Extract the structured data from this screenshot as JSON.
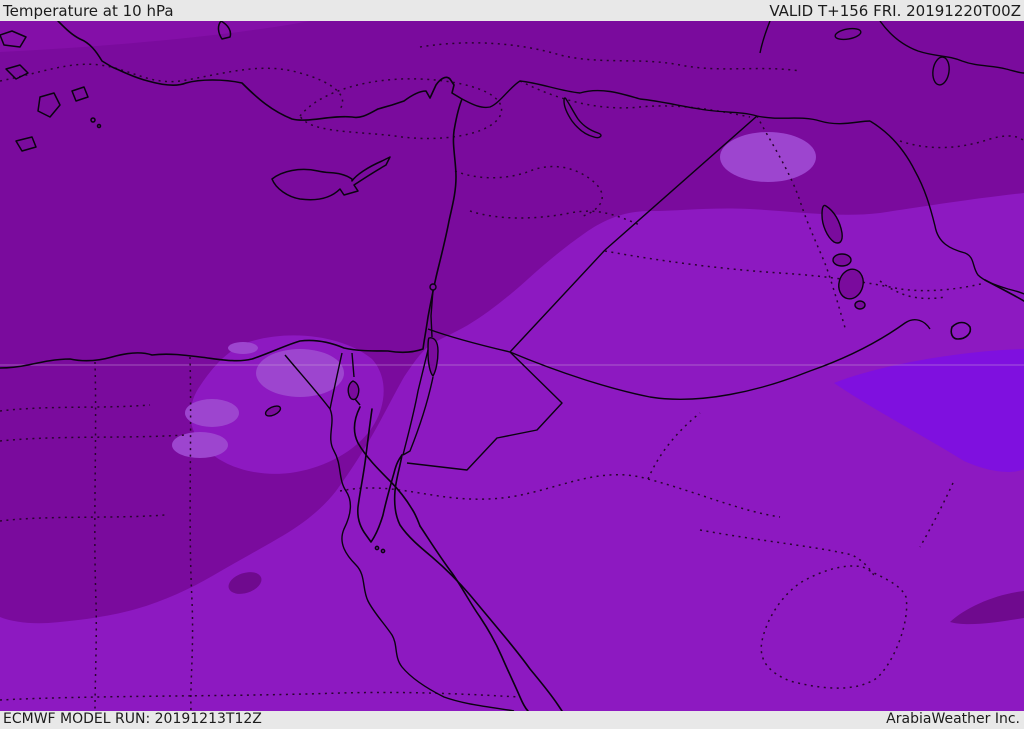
{
  "header": {
    "title": "Temperature at 10 hPa",
    "valid_time": "VALID T+156 FRI. 20191220T00Z"
  },
  "footer": {
    "model_run": "ECMWF MODEL RUN: 20191213T12Z",
    "credit": "ArabiaWeather Inc."
  },
  "map": {
    "description": "ECMWF forecast map of temperature at 10 hPa over the Middle East (Turkey, Cyprus, Levant, Egypt, Iraq, Saudi Arabia) shown as purple shaded temperature bands with black coastlines, solid country borders and dotted administrative boundaries",
    "colors": {
      "bar_bg": "#e8e8e8",
      "bar_text": "#1c1c1c",
      "band_dark": "#7a0b9d",
      "band_dark2": "#8a12ae",
      "band_medium": "#8d19c1",
      "band_light": "#9d45cf",
      "band_bright": "#7f10df",
      "band_darker": "#6f0a8e",
      "border_line": "#0a0310",
      "admin_dotted": "#2a0430",
      "graticule": "#c9a0d8"
    }
  }
}
